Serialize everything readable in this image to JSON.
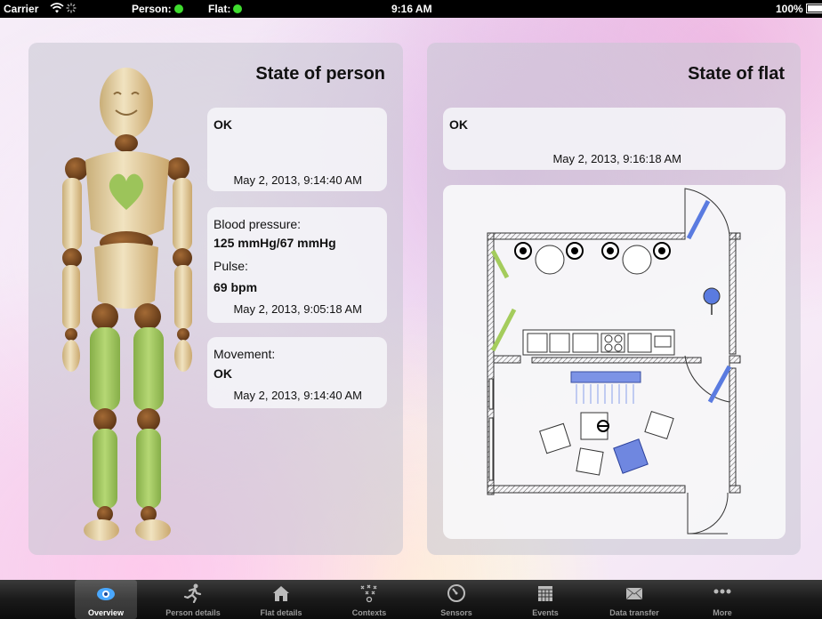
{
  "status_bar": {
    "carrier": "Carrier",
    "person_label": "Person:",
    "flat_label": "Flat:",
    "time": "9:16 AM",
    "battery": "100%"
  },
  "person_panel": {
    "title": "State of person",
    "state_card": {
      "status": "OK",
      "timestamp": "May 2, 2013, 9:14:40 AM"
    },
    "vitals_card": {
      "bp_label": "Blood pressure:",
      "bp_value": "125 mmHg/67 mmHg",
      "pulse_label": "Pulse:",
      "pulse_value": "69 bpm",
      "timestamp": "May 2, 2013, 9:05:18 AM"
    },
    "movement_card": {
      "label": "Movement:",
      "status": "OK",
      "timestamp": "May 2, 2013, 9:14:40 AM"
    }
  },
  "flat_panel": {
    "title": "State of flat",
    "state_card": {
      "status": "OK",
      "timestamp": "May 2, 2013, 9:16:18 AM"
    }
  },
  "tabs": [
    {
      "label": "Overview",
      "icon": "eye-icon",
      "active": true
    },
    {
      "label": "Person details",
      "icon": "running-person-icon"
    },
    {
      "label": "Flat details",
      "icon": "house-icon"
    },
    {
      "label": "Contexts",
      "icon": "contexts-icon"
    },
    {
      "label": "Sensors",
      "icon": "gauge-icon"
    },
    {
      "label": "Events",
      "icon": "calendar-icon"
    },
    {
      "label": "Data transfer",
      "icon": "envelope-icon"
    },
    {
      "label": "More",
      "icon": "more-dots-icon"
    }
  ],
  "colors": {
    "status_ok": "#3fdc2f",
    "figure_wood": "#e8d5a8",
    "figure_joint": "#7a4a22",
    "figure_highlight": "#9cc45a",
    "active_device": "#4a6fd8"
  }
}
